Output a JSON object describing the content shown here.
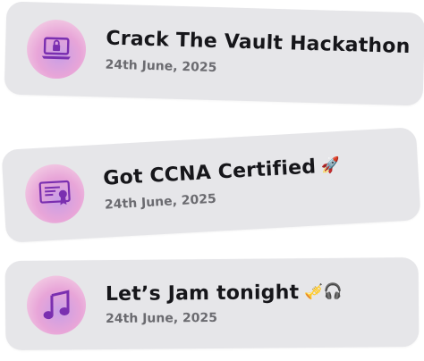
{
  "cards": [
    {
      "title": "Crack The Vault Hackathon",
      "date": "24th June, 2025",
      "icon": "lock-laptop-icon",
      "emoji": ""
    },
    {
      "title": "Got CCNA Certified",
      "date": "24th June, 2025",
      "icon": "certificate-icon",
      "emoji": "🚀"
    },
    {
      "title": "Let’s Jam tonight",
      "date": "24th June, 2025",
      "icon": "music-note-icon",
      "emoji": "🎺🎧"
    }
  ],
  "colors": {
    "card_bg": "#e6e6e9",
    "title": "#16161a",
    "date": "#6b6b70",
    "icon_stroke": "#7a2fb0",
    "icon_gradient": [
      "#c89ee6",
      "#e8a5d8",
      "#f6dcee"
    ]
  }
}
